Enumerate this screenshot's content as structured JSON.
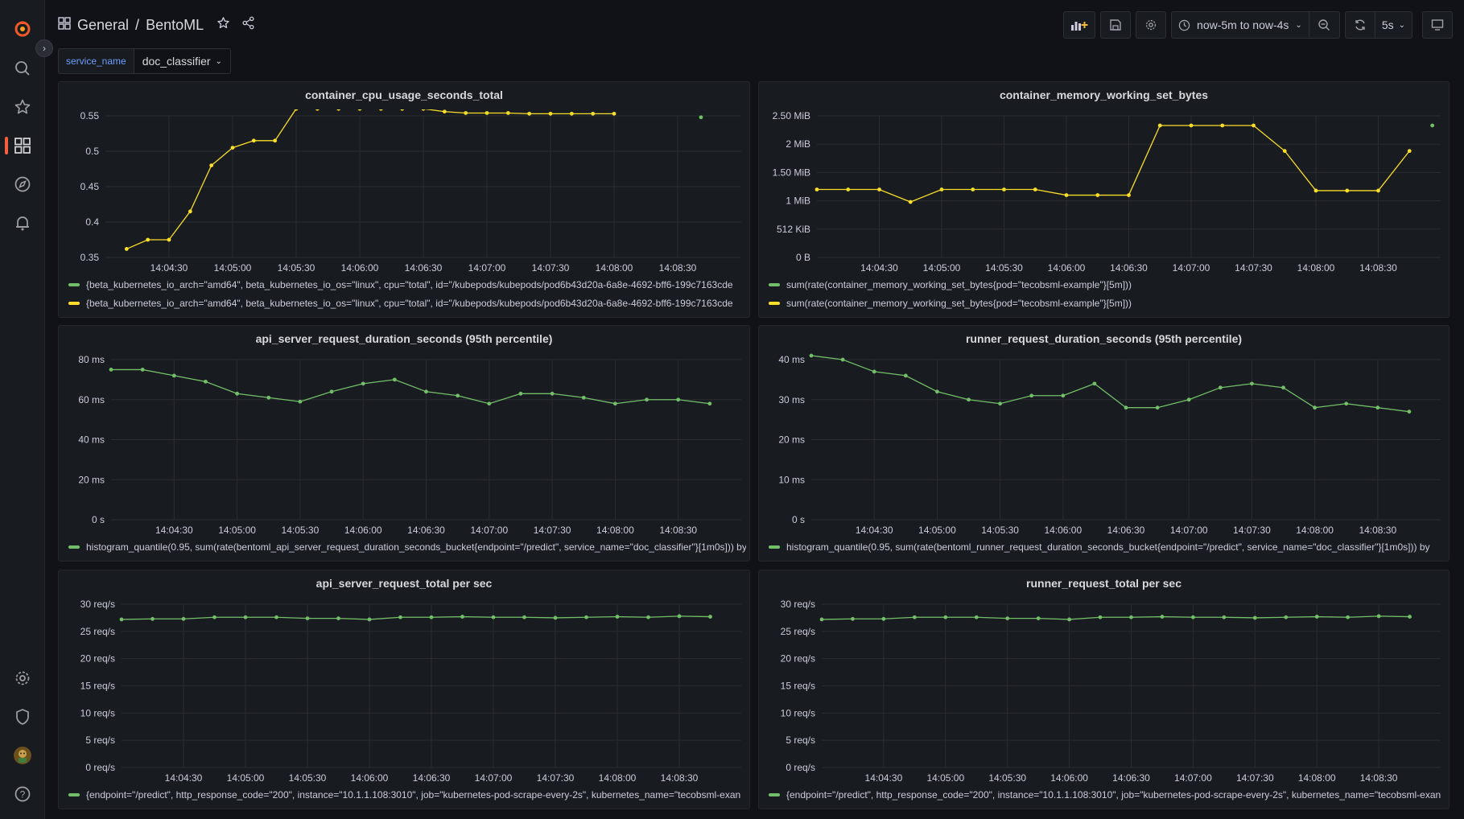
{
  "colors": {
    "green": "#73bf69",
    "yellow": "#fade2a",
    "accent": "#f55f3e"
  },
  "sidebar": {
    "icons": [
      "grafana-logo-icon",
      "search-icon",
      "starred-icon",
      "dashboards-icon",
      "explore-icon",
      "alerting-icon",
      "configuration-icon",
      "server-admin-icon",
      "user-avatar",
      "help-icon"
    ]
  },
  "header": {
    "folder": "General",
    "separator": "/",
    "title": "BentoML",
    "time_range": "now-5m to now-4s",
    "refresh": "5s"
  },
  "variables": [
    {
      "label": "service_name",
      "value": "doc_classifier"
    }
  ],
  "x_ticks": [
    "14:04:30",
    "14:05:00",
    "14:05:30",
    "14:06:00",
    "14:06:30",
    "14:07:00",
    "14:07:30",
    "14:08:00",
    "14:08:30"
  ],
  "panels": [
    {
      "title": "container_cpu_usage_seconds_total",
      "legend": [
        {
          "color": "#73bf69",
          "text": "{beta_kubernetes_io_arch=\"amd64\", beta_kubernetes_io_os=\"linux\", cpu=\"total\", id=\"/kubepods/kubepods/pod6b43d20a-6a8e-4692-bff6-199c7163cde"
        },
        {
          "color": "#fade2a",
          "text": "{beta_kubernetes_io_arch=\"amd64\", beta_kubernetes_io_os=\"linux\", cpu=\"total\", id=\"/kubepods/kubepods/pod6b43d20a-6a8e-4692-bff6-199c7163cde"
        }
      ]
    },
    {
      "title": "container_memory_working_set_bytes",
      "legend": [
        {
          "color": "#73bf69",
          "text": "sum(rate(container_memory_working_set_bytes{pod=\"tecobsml-example\"}[5m]))"
        },
        {
          "color": "#fade2a",
          "text": "sum(rate(container_memory_working_set_bytes{pod=\"tecobsml-example\"}[5m]))"
        }
      ]
    },
    {
      "title": "api_server_request_duration_seconds (95th percentile)",
      "legend": [
        {
          "color": "#73bf69",
          "text": "histogram_quantile(0.95, sum(rate(bentoml_api_server_request_duration_seconds_bucket{endpoint=\"/predict\", service_name=\"doc_classifier\"}[1m0s])) by"
        }
      ]
    },
    {
      "title": "runner_request_duration_seconds (95th percentile)",
      "legend": [
        {
          "color": "#73bf69",
          "text": "histogram_quantile(0.95, sum(rate(bentoml_runner_request_duration_seconds_bucket{endpoint=\"/predict\", service_name=\"doc_classifier\"}[1m0s])) by"
        }
      ]
    },
    {
      "title": "api_server_request_total per sec",
      "legend": [
        {
          "color": "#73bf69",
          "text": "{endpoint=\"/predict\", http_response_code=\"200\", instance=\"10.1.1.108:3010\", job=\"kubernetes-pod-scrape-every-2s\", kubernetes_name=\"tecobsml-exan"
        }
      ]
    },
    {
      "title": "runner_request_total per sec",
      "legend": [
        {
          "color": "#73bf69",
          "text": "{endpoint=\"/predict\", http_response_code=\"200\", instance=\"10.1.1.108:3010\", job=\"kubernetes-pod-scrape-every-2s\", kubernetes_name=\"tecobsml-exan"
        }
      ]
    }
  ],
  "chart_data": [
    {
      "type": "line",
      "title": "container_cpu_usage_seconds_total",
      "y_ticks": [
        "0.35",
        "0.4",
        "0.45",
        "0.5",
        "0.55"
      ],
      "ylim": [
        0.35,
        0.55
      ],
      "grid": true,
      "series": [
        {
          "color": "#fade2a",
          "x": [
            "14:04:10",
            "14:04:20",
            "14:04:30",
            "14:04:40",
            "14:04:50",
            "14:05:00",
            "14:05:10",
            "14:05:20",
            "14:05:30",
            "14:05:40",
            "14:05:50",
            "14:06:00",
            "14:06:10",
            "14:06:20",
            "14:06:30",
            "14:06:40",
            "14:06:50",
            "14:07:00",
            "14:07:10",
            "14:07:20",
            "14:07:30",
            "14:07:40",
            "14:07:50",
            "14:08:00"
          ],
          "values": [
            0.362,
            0.375,
            0.375,
            0.415,
            0.48,
            0.505,
            0.515,
            0.515,
            0.56,
            0.56,
            0.56,
            0.56,
            0.56,
            0.56,
            0.56,
            0.556,
            0.554,
            0.554,
            0.554,
            0.553,
            0.553,
            0.553,
            0.553,
            0.553
          ]
        },
        {
          "color": "#73bf69",
          "x": [
            "14:08:41"
          ],
          "values": [
            0.548
          ]
        }
      ]
    },
    {
      "type": "line",
      "title": "container_memory_working_set_bytes",
      "y_ticks": [
        "0 B",
        "512 KiB",
        "1 MiB",
        "1.50 MiB",
        "2 MiB",
        "2.50 MiB"
      ],
      "ylim": [
        0,
        2.5
      ],
      "grid": true,
      "series": [
        {
          "color": "#fade2a",
          "x": [
            "14:04:00",
            "14:04:15",
            "14:04:30",
            "14:04:45",
            "14:05:00",
            "14:05:15",
            "14:05:30",
            "14:05:45",
            "14:06:00",
            "14:06:15",
            "14:06:30",
            "14:06:45",
            "14:07:00",
            "14:07:15",
            "14:07:30",
            "14:07:45",
            "14:08:00",
            "14:08:15",
            "14:08:30",
            "14:08:45"
          ],
          "values": [
            1.2,
            1.2,
            1.2,
            0.98,
            1.2,
            1.2,
            1.2,
            1.2,
            1.1,
            1.1,
            1.1,
            2.33,
            2.33,
            2.33,
            2.33,
            1.88,
            1.18,
            1.18,
            1.18,
            1.88
          ]
        },
        {
          "color": "#73bf69",
          "x": [
            "14:08:56"
          ],
          "values": [
            2.33
          ]
        }
      ]
    },
    {
      "type": "line",
      "title": "api_server_request_duration_seconds (95th percentile)",
      "y_ticks": [
        "0 s",
        "20 ms",
        "40 ms",
        "60 ms",
        "80 ms"
      ],
      "ylim": [
        0,
        80
      ],
      "grid": true,
      "series": [
        {
          "color": "#73bf69",
          "x": [
            "14:04:00",
            "14:04:15",
            "14:04:30",
            "14:04:45",
            "14:05:00",
            "14:05:15",
            "14:05:30",
            "14:05:45",
            "14:06:00",
            "14:06:15",
            "14:06:30",
            "14:06:45",
            "14:07:00",
            "14:07:15",
            "14:07:30",
            "14:07:45",
            "14:08:00",
            "14:08:15",
            "14:08:30",
            "14:08:45"
          ],
          "values": [
            75,
            75,
            72,
            69,
            63,
            61,
            59,
            64,
            68,
            70,
            64,
            62,
            58,
            63,
            63,
            61,
            58,
            60,
            60,
            58
          ]
        }
      ]
    },
    {
      "type": "line",
      "title": "runner_request_duration_seconds (95th percentile)",
      "y_ticks": [
        "0 s",
        "10 ms",
        "20 ms",
        "30 ms",
        "40 ms"
      ],
      "ylim": [
        0,
        40
      ],
      "grid": true,
      "series": [
        {
          "color": "#73bf69",
          "x": [
            "14:04:00",
            "14:04:15",
            "14:04:30",
            "14:04:45",
            "14:05:00",
            "14:05:15",
            "14:05:30",
            "14:05:45",
            "14:06:00",
            "14:06:15",
            "14:06:30",
            "14:06:45",
            "14:07:00",
            "14:07:15",
            "14:07:30",
            "14:07:45",
            "14:08:00",
            "14:08:15",
            "14:08:30",
            "14:08:45"
          ],
          "values": [
            41,
            40,
            37,
            36,
            32,
            30,
            29,
            31,
            31,
            34,
            28,
            28,
            30,
            33,
            34,
            33,
            28,
            29,
            28,
            27
          ]
        }
      ]
    },
    {
      "type": "line",
      "title": "api_server_request_total per sec",
      "y_ticks": [
        "0 req/s",
        "5 req/s",
        "10 req/s",
        "15 req/s",
        "20 req/s",
        "25 req/s",
        "30 req/s"
      ],
      "ylim": [
        0,
        30
      ],
      "grid": true,
      "series": [
        {
          "color": "#73bf69",
          "x": [
            "14:04:00",
            "14:04:15",
            "14:04:30",
            "14:04:45",
            "14:05:00",
            "14:05:15",
            "14:05:30",
            "14:05:45",
            "14:06:00",
            "14:06:15",
            "14:06:30",
            "14:06:45",
            "14:07:00",
            "14:07:15",
            "14:07:30",
            "14:07:45",
            "14:08:00",
            "14:08:15",
            "14:08:30",
            "14:08:45"
          ],
          "values": [
            27.2,
            27.3,
            27.3,
            27.6,
            27.6,
            27.6,
            27.4,
            27.4,
            27.2,
            27.6,
            27.6,
            27.7,
            27.6,
            27.6,
            27.5,
            27.6,
            27.7,
            27.6,
            27.8,
            27.7
          ]
        }
      ]
    },
    {
      "type": "line",
      "title": "runner_request_total per sec",
      "y_ticks": [
        "0 req/s",
        "5 req/s",
        "10 req/s",
        "15 req/s",
        "20 req/s",
        "25 req/s",
        "30 req/s"
      ],
      "ylim": [
        0,
        30
      ],
      "grid": true,
      "series": [
        {
          "color": "#73bf69",
          "x": [
            "14:04:00",
            "14:04:15",
            "14:04:30",
            "14:04:45",
            "14:05:00",
            "14:05:15",
            "14:05:30",
            "14:05:45",
            "14:06:00",
            "14:06:15",
            "14:06:30",
            "14:06:45",
            "14:07:00",
            "14:07:15",
            "14:07:30",
            "14:07:45",
            "14:08:00",
            "14:08:15",
            "14:08:30",
            "14:08:45"
          ],
          "values": [
            27.2,
            27.3,
            27.3,
            27.6,
            27.6,
            27.6,
            27.4,
            27.4,
            27.2,
            27.6,
            27.6,
            27.7,
            27.6,
            27.6,
            27.5,
            27.6,
            27.7,
            27.6,
            27.8,
            27.7
          ]
        }
      ]
    }
  ]
}
